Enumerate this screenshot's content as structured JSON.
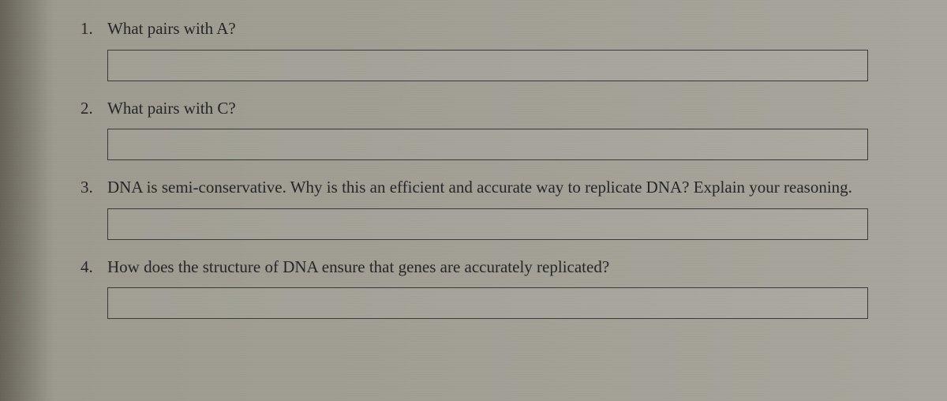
{
  "questions": [
    {
      "number": "1.",
      "text": "What pairs with A?",
      "answer": ""
    },
    {
      "number": "2.",
      "text": "What pairs with C?",
      "answer": ""
    },
    {
      "number": "3.",
      "text": "DNA is semi-conservative. Why is this an efficient and accurate way to replicate DNA? Explain your reasoning.",
      "answer": ""
    },
    {
      "number": "4.",
      "text": "How does the structure of DNA ensure that genes are accurately replicated?",
      "answer": ""
    }
  ]
}
